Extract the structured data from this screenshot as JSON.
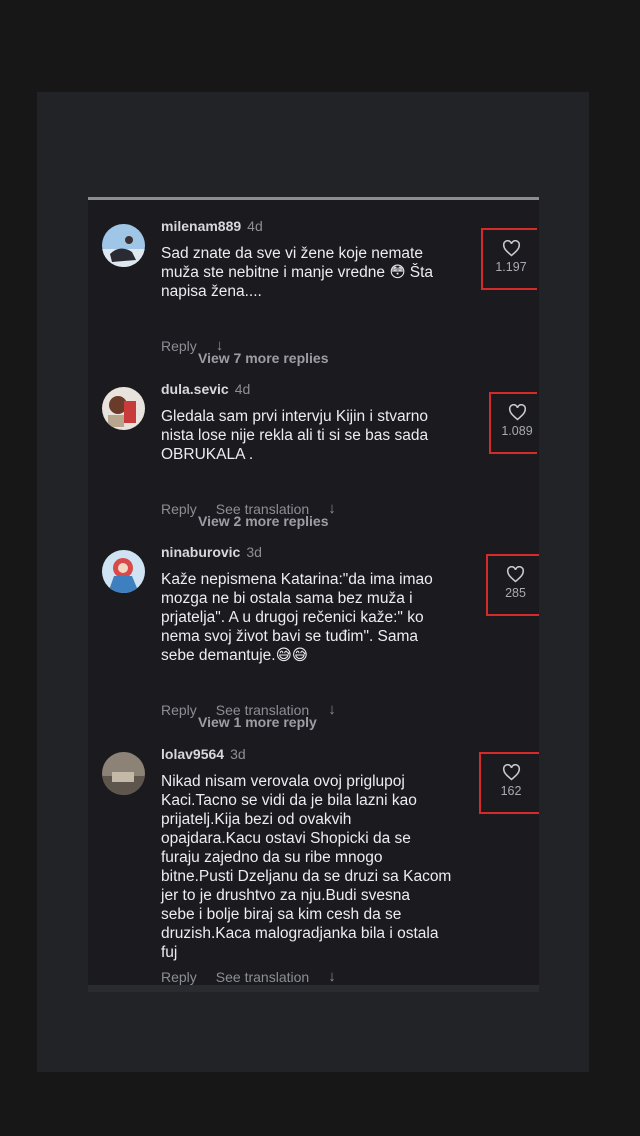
{
  "comments": [
    {
      "username": "milenam889",
      "time": "4d",
      "text": "Sad znate da sve vi žene koje nemate\nmuža ste nebitne i manje vredne 😳 Šta\nnapisa žena....",
      "reply": "Reply",
      "translate": "",
      "likes": "1.197"
    },
    {
      "username": "dula.sevic",
      "time": "4d",
      "text": "Gledala sam prvi intervju Kijin i stvarno\nnista lose nije rekla ali ti si se bas sada\nOBRUKALA .",
      "reply": "Reply",
      "translate": "See translation",
      "likes": "1.089"
    },
    {
      "username": "ninaburovic",
      "time": "3d",
      "text": "Kaže nepismena Katarina:\"da ima imao\nmozga ne bi ostala sama bez muža i\nprjatelja\". A u drugoj rečenici kaže:\" ko\nnema svoj život bavi se tuđim\". Sama\nsebe demantuje.😅😅",
      "reply": "Reply",
      "translate": "See translation",
      "likes": "285"
    },
    {
      "username": "lolav9564",
      "time": "3d",
      "text": "Nikad nisam verovala ovoj priglupoj\nKaci.Tacno se vidi da je bila lazni kao\nprijatelj.Kija bezi od ovakvih\nopajdara.Kacu ostavi Shopicki da se\nfuraju zajedno da su ribe mnogo\nbitne.Pusti Dzeljanu da se druzi sa Kacom\njer to je drushtvo za nju.Budi svesna\nsebe i bolje biraj sa kim cesh da se\ndruzish.Kaca malogradjanka bila i ostala\nfuj",
      "reply": "Reply",
      "translate": "See translation",
      "likes": "162"
    }
  ],
  "view_more": [
    "View 7 more replies",
    "View 2 more replies",
    "View 1 more reply"
  ],
  "icons": {
    "like": "heart-outline-icon",
    "sort": "down-arrow-icon"
  },
  "colors": {
    "highlight_box": "#d42a2a",
    "sheet_bg": "#1b1b1f",
    "text": "#ededf0",
    "muted": "#8d8e94"
  }
}
